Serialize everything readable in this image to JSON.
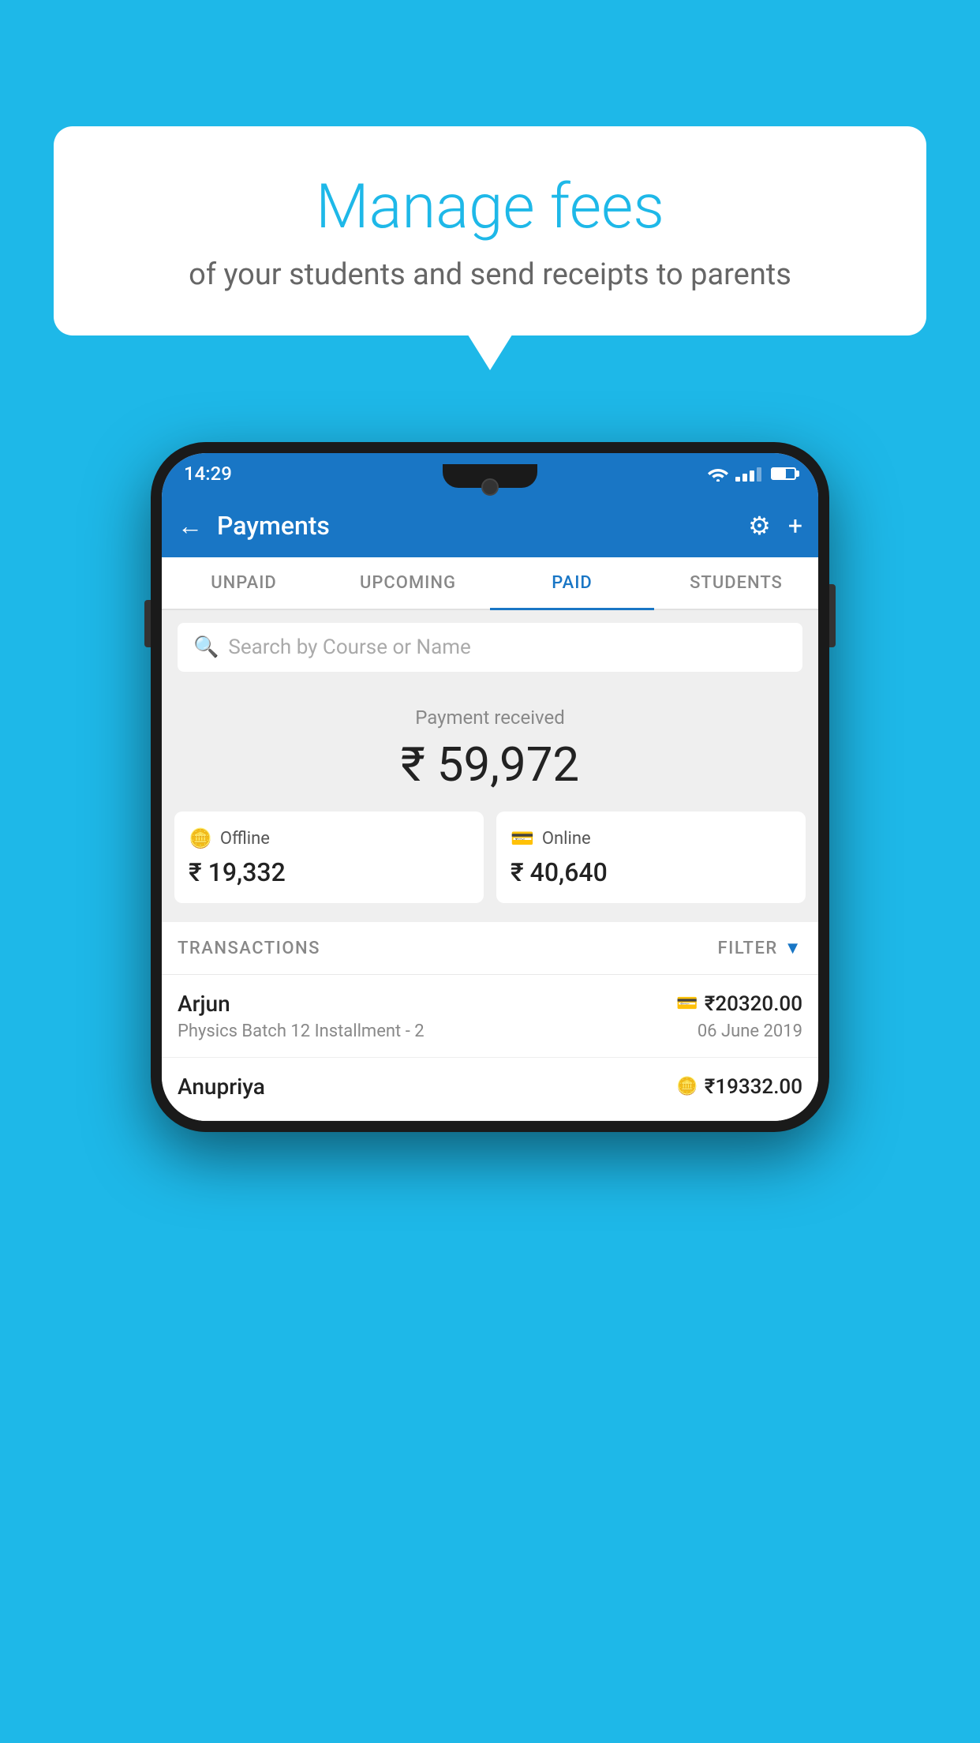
{
  "background_color": "#1eb8e8",
  "bubble": {
    "title": "Manage fees",
    "subtitle": "of your students and send receipts to parents"
  },
  "status_bar": {
    "time": "14:29"
  },
  "app_bar": {
    "title": "Payments",
    "back_label": "←",
    "gear_label": "⚙",
    "plus_label": "+"
  },
  "tabs": [
    {
      "label": "UNPAID",
      "active": false
    },
    {
      "label": "UPCOMING",
      "active": false
    },
    {
      "label": "PAID",
      "active": true
    },
    {
      "label": "STUDENTS",
      "active": false
    }
  ],
  "search": {
    "placeholder": "Search by Course or Name"
  },
  "payment_summary": {
    "received_label": "Payment received",
    "amount": "₹ 59,972",
    "offline_label": "Offline",
    "offline_amount": "₹ 19,332",
    "online_label": "Online",
    "online_amount": "₹ 40,640"
  },
  "transactions_section": {
    "label": "TRANSACTIONS",
    "filter_label": "FILTER"
  },
  "transactions": [
    {
      "name": "Arjun",
      "course": "Physics Batch 12 Installment - 2",
      "amount": "₹20320.00",
      "date": "06 June 2019",
      "payment_type": "online"
    },
    {
      "name": "Anupriya",
      "course": "",
      "amount": "₹19332.00",
      "date": "",
      "payment_type": "offline"
    }
  ]
}
